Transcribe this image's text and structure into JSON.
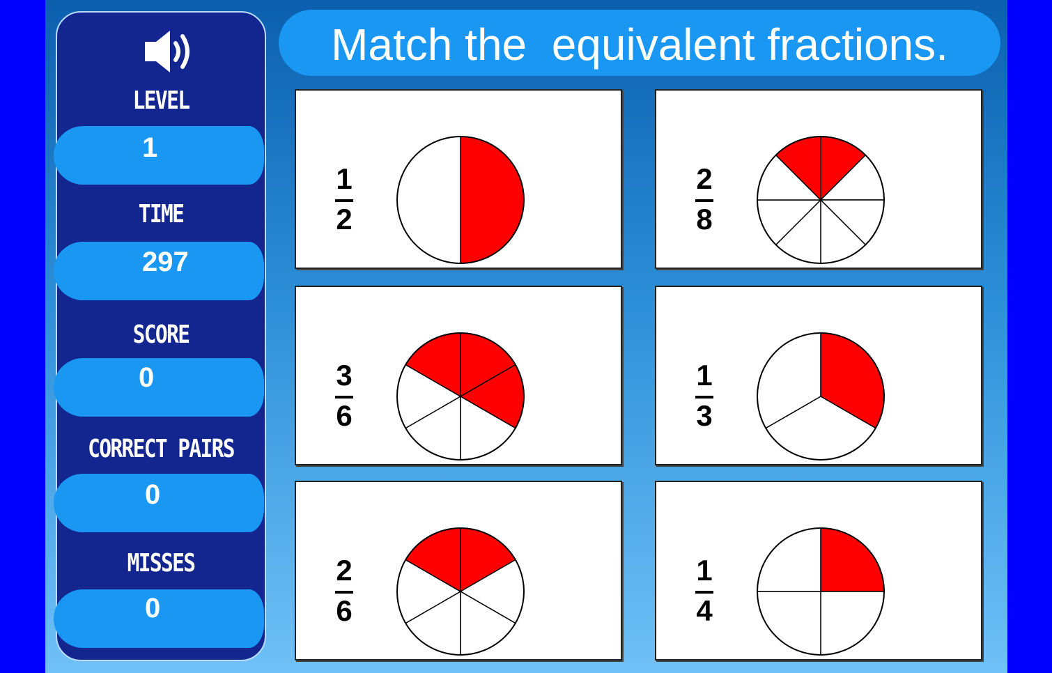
{
  "title": "Match the  equivalent fractions.",
  "sound_icon": "speaker-icon",
  "stats": {
    "level_label": "LEVEL",
    "level_value": "1",
    "time_label": "TIME",
    "time_value": "297",
    "score_label": "SCORE",
    "score_value": "0",
    "pairs_label": "CORRECT PAIRS",
    "pairs_value": "0",
    "misses_label": "MISSES",
    "misses_value": "0"
  },
  "cards": [
    {
      "numerator": "1",
      "denominator": "2",
      "slices": 2,
      "shaded": [
        0
      ]
    },
    {
      "numerator": "2",
      "denominator": "8",
      "slices": 8,
      "shaded": [
        7,
        0
      ]
    },
    {
      "numerator": "3",
      "denominator": "6",
      "slices": 6,
      "shaded": [
        5,
        0,
        1
      ]
    },
    {
      "numerator": "1",
      "denominator": "3",
      "slices": 3,
      "shaded": [
        0
      ]
    },
    {
      "numerator": "2",
      "denominator": "6",
      "slices": 6,
      "shaded": [
        5,
        0
      ]
    },
    {
      "numerator": "1",
      "denominator": "4",
      "slices": 4,
      "shaded": [
        0
      ]
    }
  ],
  "colors": {
    "shaded": "#ff0000",
    "unshaded": "#ffffff",
    "outline": "#000000"
  }
}
